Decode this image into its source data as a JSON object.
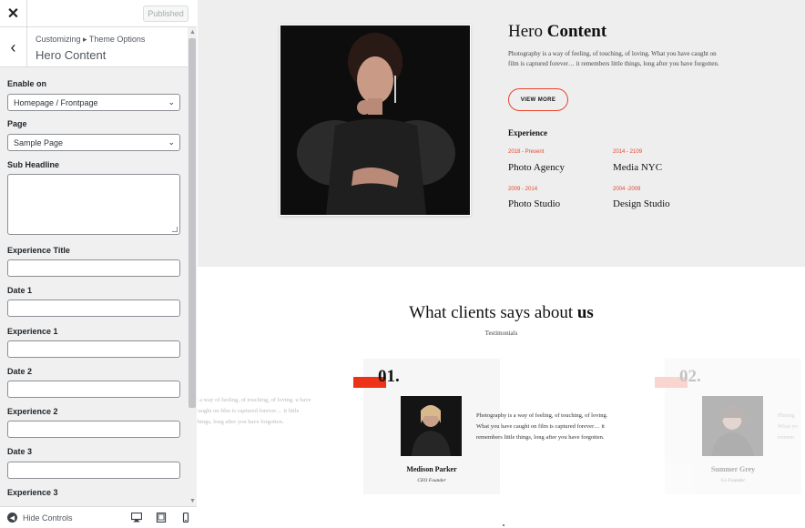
{
  "customizer": {
    "close_icon": "close-icon",
    "published_label": "Published",
    "breadcrumb": "Customizing ▸ Theme Options",
    "section_title": "Hero Content",
    "controls": {
      "enable_on": {
        "label": "Enable on",
        "value": "Homepage / Frontpage"
      },
      "page": {
        "label": "Page",
        "value": "Sample Page"
      },
      "sub_headline": {
        "label": "Sub Headline",
        "value": ""
      },
      "experience_title": {
        "label": "Experience Title",
        "value": ""
      },
      "date_1": {
        "label": "Date 1",
        "value": ""
      },
      "experience_1": {
        "label": "Experience 1",
        "value": ""
      },
      "date_2": {
        "label": "Date 2",
        "value": ""
      },
      "experience_2": {
        "label": "Experience 2",
        "value": ""
      },
      "date_3": {
        "label": "Date 3",
        "value": ""
      },
      "experience_3": {
        "label": "Experience 3"
      }
    },
    "footer": {
      "hide_label": "Hide Controls"
    }
  },
  "hero": {
    "title_regular": "Hero ",
    "title_bold": "Content",
    "text": "Photography is a way of feeling, of touching, of loving. What you have caught on film is captured forever… it remembers little things, long after you have forgotten.",
    "button_label": "VIEW MORE",
    "experience_title": "Experience",
    "experiences": [
      {
        "date": "2018 - Present",
        "name": "Photo Agency"
      },
      {
        "date": "2014 - 2109",
        "name": "Media NYC"
      },
      {
        "date": "2009 - 2014",
        "name": "Photo Studio"
      },
      {
        "date": "2004 -2009",
        "name": "Design Studio"
      }
    ]
  },
  "testimonials": {
    "title_regular": "What clients says about ",
    "title_bold": "us",
    "subtitle": "Testimonials",
    "quote_left_partial": "s a way of feeling, of touching, of loving. u have caught on film is captured forever… it little things, long after you have forgotten.",
    "items": [
      {
        "number": "01.",
        "name": "Medison Parker",
        "role": "CEO Founder",
        "quote": "Photography is a way of feeling, of touching, of loving. What you have caught on film is captured forever… it remembers little things, long after you have forgotten."
      },
      {
        "number": "02.",
        "name": "Summer Grey",
        "role": "Co Founder",
        "quote": "Photog What yo remem"
      }
    ]
  },
  "colors": {
    "accent": "#e8452c",
    "bar": "#ee3217",
    "wp_blue": "#2271b1"
  }
}
